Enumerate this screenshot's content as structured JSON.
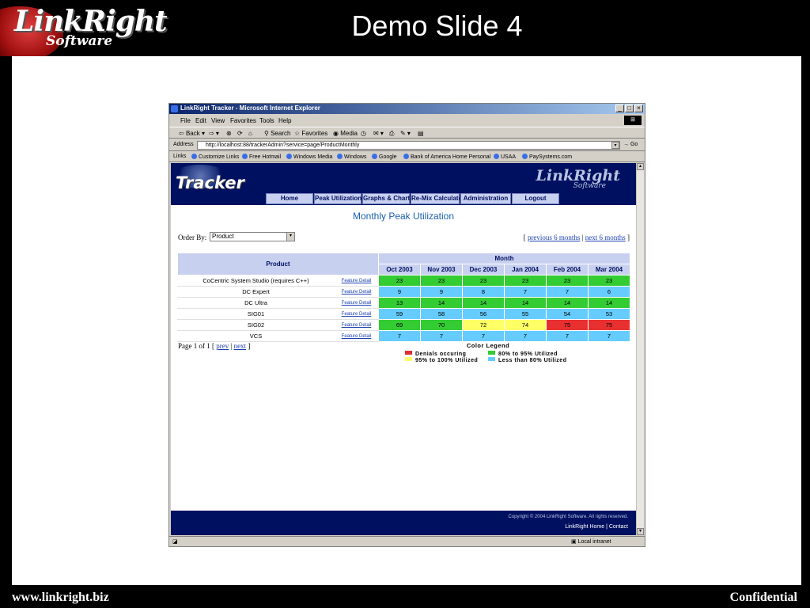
{
  "slide": {
    "logo_text": "LinkRight",
    "logo_sub": "Software",
    "title": "Demo Slide 4",
    "footer_left": "www.linkright.biz",
    "footer_right": "Confidential"
  },
  "browser": {
    "window_title": "LinkRight Tracker - Microsoft Internet Explorer",
    "menu": [
      "File",
      "Edit",
      "View",
      "Favorites",
      "Tools",
      "Help"
    ],
    "toolbar": {
      "back": "Back",
      "search": "Search",
      "favorites": "Favorites",
      "media": "Media"
    },
    "address_label": "Address",
    "address_url": "http://localhost:88/trackerAdmin?service=page/ProductMonthly",
    "go_label": "Go",
    "links_label": "Links",
    "links": [
      "Customize Links",
      "Free Hotmail",
      "Windows Media",
      "Windows",
      "Google",
      "Bank of America  Home  Personal",
      "USAA",
      "PaySystems.com"
    ],
    "status_zone": "Local intranet"
  },
  "app": {
    "tracker_logo": "Tracker",
    "brand": "LinkRight",
    "brand_sub": "Software",
    "nav": [
      "Home",
      "Peak Utilization",
      "Graphs & Charts",
      "Re-Mix Calculator",
      "Administration",
      "Logout"
    ],
    "page_title": "Monthly Peak Utilization",
    "order_by_label": "Order By:",
    "order_by_value": "Product",
    "pager_prev": "previous 6 months",
    "pager_next": "next 6 months",
    "page_info": "Page 1 of 1 [",
    "prev_label": "prev",
    "next_label": "next",
    "copyright": "Copyright © 2004 LinkRight Software. All rights reserved.",
    "footer_home": "LinkRight Home",
    "footer_contact": "Contact"
  },
  "table": {
    "product_header": "Product",
    "month_header": "Month",
    "months": [
      "Oct 2003",
      "Nov 2003",
      "Dec 2003",
      "Jan 2004",
      "Feb 2004",
      "Mar 2004"
    ],
    "feature_link": "Feature Detail",
    "rows": [
      {
        "product": "CoCentric System Studio (requires C++)",
        "values": [
          23,
          23,
          23,
          23,
          23,
          23
        ],
        "levels": [
          "g",
          "g",
          "g",
          "g",
          "g",
          "g"
        ]
      },
      {
        "product": "DC Expert",
        "values": [
          9,
          9,
          8,
          7,
          7,
          6
        ],
        "levels": [
          "b",
          "b",
          "b",
          "b",
          "b",
          "b"
        ]
      },
      {
        "product": "DC Ultra",
        "values": [
          13,
          14,
          14,
          14,
          14,
          14
        ],
        "levels": [
          "g",
          "g",
          "g",
          "g",
          "g",
          "g"
        ]
      },
      {
        "product": "SIG01",
        "values": [
          59,
          58,
          56,
          55,
          54,
          53
        ],
        "levels": [
          "b",
          "b",
          "b",
          "b",
          "b",
          "b"
        ]
      },
      {
        "product": "SIG02",
        "values": [
          69,
          70,
          72,
          74,
          75,
          75
        ],
        "levels": [
          "g",
          "g",
          "y",
          "y",
          "r",
          "r"
        ]
      },
      {
        "product": "VCS",
        "values": [
          7,
          7,
          7,
          7,
          7,
          7
        ],
        "levels": [
          "b",
          "b",
          "b",
          "b",
          "b",
          "b"
        ]
      }
    ]
  },
  "legend": {
    "title": "Color Legend",
    "items": [
      {
        "label": "Denials occuring",
        "color": "#e03030"
      },
      {
        "label": "80% to 95% Utilized",
        "color": "#33cc33"
      },
      {
        "label": "95% to 100% Utilized",
        "color": "#ffff66"
      },
      {
        "label": "Less than 80% Utilized",
        "color": "#66ccff"
      }
    ]
  },
  "colors": {
    "r": "#e83030",
    "g": "#33cc33",
    "y": "#ffff66",
    "b": "#66ccff",
    "nav_bg": "#001060",
    "title": "#1a5fb0"
  }
}
